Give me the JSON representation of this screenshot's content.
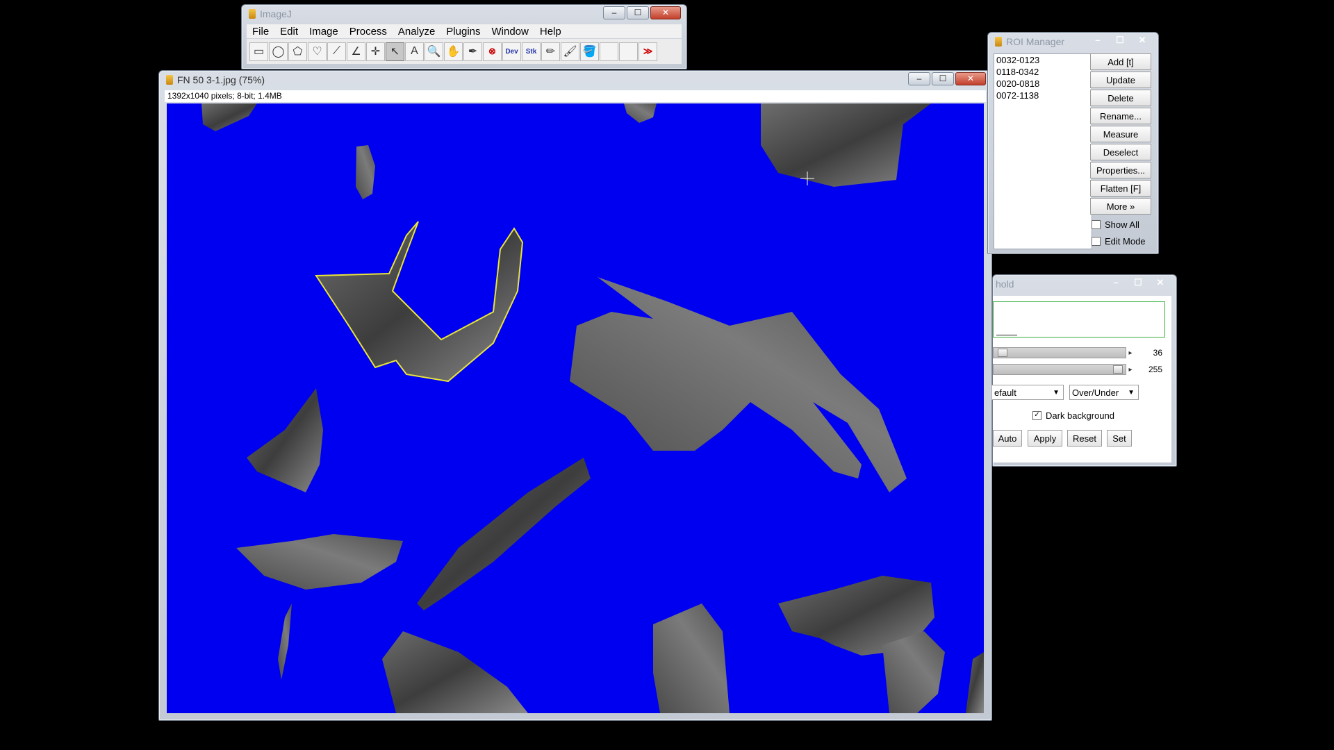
{
  "imagej": {
    "title": "ImageJ",
    "menu": [
      "File",
      "Edit",
      "Image",
      "Process",
      "Analyze",
      "Plugins",
      "Window",
      "Help"
    ],
    "tools": [
      {
        "name": "rectangle-tool",
        "glyph": "▭"
      },
      {
        "name": "oval-tool",
        "glyph": "◯"
      },
      {
        "name": "polygon-tool",
        "glyph": "⬠"
      },
      {
        "name": "freehand-tool",
        "glyph": "♡"
      },
      {
        "name": "line-tool",
        "glyph": "⟋"
      },
      {
        "name": "angle-tool",
        "glyph": "∠"
      },
      {
        "name": "point-tool",
        "glyph": "✛"
      },
      {
        "name": "wand-tool",
        "glyph": "↖"
      },
      {
        "name": "text-tool",
        "glyph": "A"
      },
      {
        "name": "magnifier-tool",
        "glyph": "🔍"
      },
      {
        "name": "scroll-tool",
        "glyph": "✋"
      },
      {
        "name": "color-picker-tool",
        "glyph": "✒"
      },
      {
        "name": "remove-overlay-tool",
        "glyph": "⊗"
      },
      {
        "name": "dev-tool",
        "glyph": "Dev"
      },
      {
        "name": "stk-tool",
        "glyph": "Stk"
      },
      {
        "name": "pencil-tool",
        "glyph": "✏"
      },
      {
        "name": "brush-tool",
        "glyph": "🖌"
      },
      {
        "name": "flood-fill-tool",
        "glyph": "🪣"
      },
      {
        "name": "empty-slot-1",
        "glyph": ""
      },
      {
        "name": "empty-slot-2",
        "glyph": ""
      },
      {
        "name": "more-tools",
        "glyph": "≫"
      }
    ]
  },
  "image_window": {
    "title": "FN 50 3-1.jpg (75%)",
    "info": "1392x1040 pixels; 8-bit; 1.4MB"
  },
  "roi_manager": {
    "title": "ROI Manager",
    "items": [
      "0032-0123",
      "0118-0342",
      "0020-0818",
      "0072-1138"
    ],
    "buttons": [
      "Add [t]",
      "Update",
      "Delete",
      "Rename...",
      "Measure",
      "Deselect",
      "Properties...",
      "Flatten [F]",
      "More »"
    ],
    "show_all_label": "Show All",
    "edit_mode_label": "Edit Mode"
  },
  "threshold": {
    "title": "hold",
    "min_value": "36",
    "max_value": "255",
    "method": "efault",
    "display": "Over/Under",
    "dark_background_label": "Dark background",
    "dark_background_checked": true,
    "buttons": {
      "auto": "Auto",
      "apply": "Apply",
      "reset": "Reset",
      "set": "Set"
    }
  },
  "colors": {
    "threshold_overlay": "#0000f0",
    "selection_outline": "#e8e43a"
  }
}
